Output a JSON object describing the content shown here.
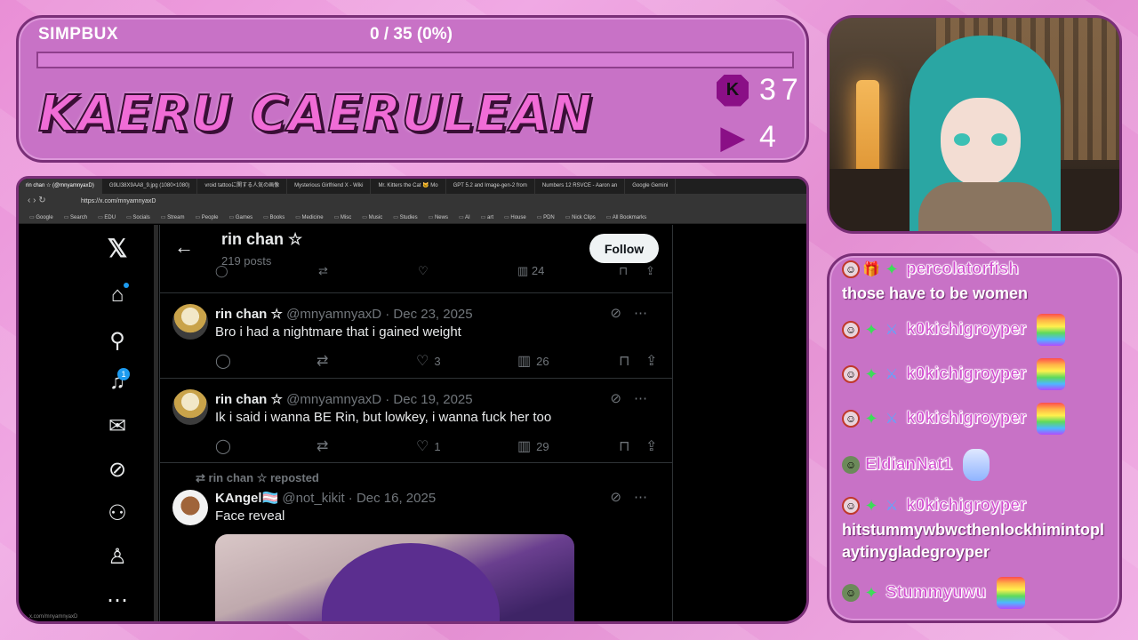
{
  "overlay": {
    "goal_label": "SIMPBUX",
    "goal_progress": "0 / 35 (0%)",
    "goal_fraction": 0,
    "streamer_name": "KAERU CAERULEAN",
    "kick_count": "37",
    "twitch_count": "4",
    "kick_icon_letter": "K",
    "colors": {
      "panel": "#c872c6",
      "border": "#7a2f78",
      "name": "#f06cd6"
    }
  },
  "browser": {
    "tabs": [
      "rin chan ☆ (@mnyamnyaxD)",
      "G9LI38X9AA8_9.jpg (1080×1080)",
      "vroid tattooに関する人気の画像",
      "Mysterious Girlfriend X - Wiki",
      "Mr. Kitters the Cat 🐱 Mo",
      "GPT 5.2 and Image-gen-2 from",
      "Numbers 12 RSVCE - Aaron an",
      "Google Gemini"
    ],
    "url": "https://x.com/mnyamnyaxD",
    "bookmarks": [
      "Google",
      "Search",
      "EDU",
      "Socials",
      "Stream",
      "People",
      "Games",
      "Books",
      "Medicine",
      "Misc",
      "Music",
      "Studies",
      "News",
      "AI",
      "art",
      "House",
      "PDN",
      "Nick Clips",
      "All Bookmarks"
    ],
    "footer_url": "x.com/mnyamnyaxD"
  },
  "x": {
    "nav_icons": [
      "x-logo-icon",
      "home-icon",
      "search-icon",
      "notifications-icon",
      "messages-icon",
      "grok-icon",
      "communities-icon",
      "profile-icon",
      "more-icon"
    ],
    "notif_count": "1",
    "profile_name": "rin chan ☆",
    "post_count": "219 posts",
    "follow_label": "Follow",
    "partial_views": "24",
    "posts": [
      {
        "name": "rin chan ☆",
        "handle": "@mnyamnyaxD · Dec 23, 2025",
        "text": "Bro i had a nightmare that i gained weight",
        "likes": "3",
        "views": "26"
      },
      {
        "name": "rin chan ☆",
        "handle": "@mnyamnyaxD · Dec 19, 2025",
        "text": "Ik i said i wanna BE Rin, but lowkey, i wanna fuck her too",
        "likes": "1",
        "views": "29"
      },
      {
        "repost_line": "rin chan ☆ reposted",
        "name": "KAngel🏳️‍⚧️",
        "handle": "@not_kikit · Dec 16, 2025",
        "text": "Face reveal"
      }
    ]
  },
  "chat": {
    "messages": [
      {
        "user": "percolatorfish",
        "text": "those have to be women"
      },
      {
        "user": "k0kichigroyper",
        "text": ""
      },
      {
        "user": "k0kichigroyper",
        "text": ""
      },
      {
        "user": "k0kichigroyper",
        "text": ""
      },
      {
        "user": "EldianNat1",
        "text": ""
      },
      {
        "user": "k0kichigroyper",
        "text": "hitstummywbwcthenlockhimintoplaytinygladegroyper"
      },
      {
        "user": "Stummyuwu",
        "text": ""
      }
    ]
  }
}
